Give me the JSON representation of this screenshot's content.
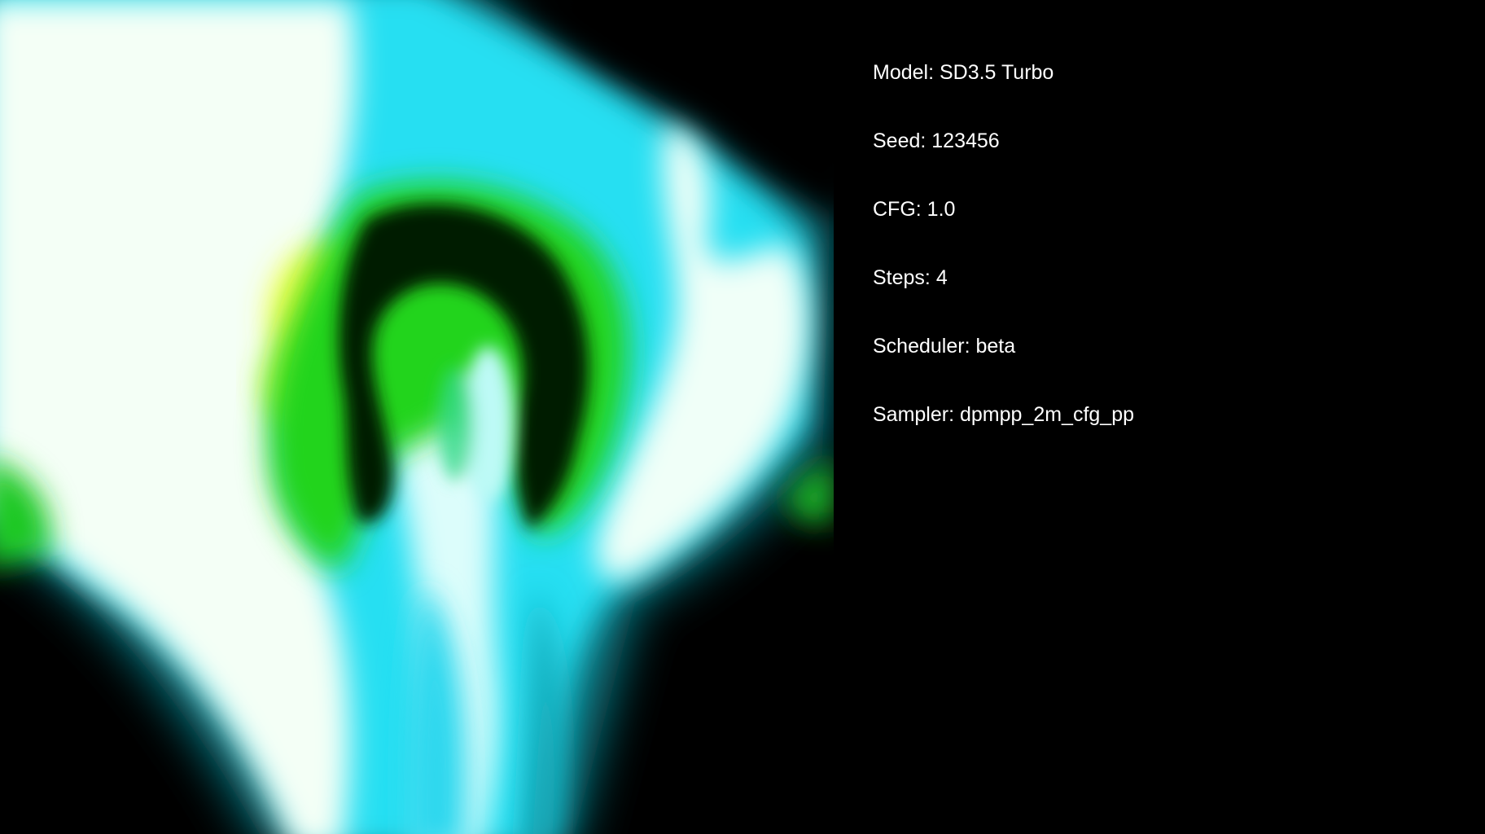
{
  "image": {
    "name": "generated-image",
    "dominant_colors": {
      "background": "#000000",
      "white_glow": "#f4fff6",
      "cyan": "#22e6ff",
      "teal": "#0fb2b8",
      "green": "#20d81c",
      "yellow": "#f0ff3a",
      "dark_green": "#021a05"
    }
  },
  "info": {
    "model": "Model: SD3.5 Turbo",
    "seed": "Seed: 123456",
    "cfg": "CFG: 1.0",
    "steps": "Steps: 4",
    "scheduler": "Scheduler: beta",
    "sampler": "Sampler: dpmpp_2m_cfg_pp"
  }
}
